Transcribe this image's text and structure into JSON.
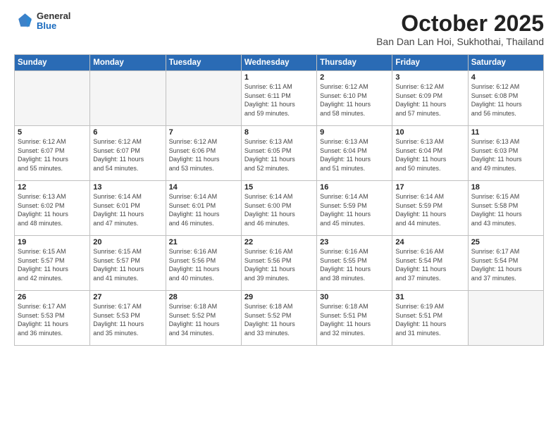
{
  "logo": {
    "general": "General",
    "blue": "Blue"
  },
  "header": {
    "month": "October 2025",
    "location": "Ban Dan Lan Hoi, Sukhothai, Thailand"
  },
  "weekdays": [
    "Sunday",
    "Monday",
    "Tuesday",
    "Wednesday",
    "Thursday",
    "Friday",
    "Saturday"
  ],
  "weeks": [
    [
      {
        "day": "",
        "info": ""
      },
      {
        "day": "",
        "info": ""
      },
      {
        "day": "",
        "info": ""
      },
      {
        "day": "1",
        "info": "Sunrise: 6:11 AM\nSunset: 6:11 PM\nDaylight: 11 hours\nand 59 minutes."
      },
      {
        "day": "2",
        "info": "Sunrise: 6:12 AM\nSunset: 6:10 PM\nDaylight: 11 hours\nand 58 minutes."
      },
      {
        "day": "3",
        "info": "Sunrise: 6:12 AM\nSunset: 6:09 PM\nDaylight: 11 hours\nand 57 minutes."
      },
      {
        "day": "4",
        "info": "Sunrise: 6:12 AM\nSunset: 6:08 PM\nDaylight: 11 hours\nand 56 minutes."
      }
    ],
    [
      {
        "day": "5",
        "info": "Sunrise: 6:12 AM\nSunset: 6:07 PM\nDaylight: 11 hours\nand 55 minutes."
      },
      {
        "day": "6",
        "info": "Sunrise: 6:12 AM\nSunset: 6:07 PM\nDaylight: 11 hours\nand 54 minutes."
      },
      {
        "day": "7",
        "info": "Sunrise: 6:12 AM\nSunset: 6:06 PM\nDaylight: 11 hours\nand 53 minutes."
      },
      {
        "day": "8",
        "info": "Sunrise: 6:13 AM\nSunset: 6:05 PM\nDaylight: 11 hours\nand 52 minutes."
      },
      {
        "day": "9",
        "info": "Sunrise: 6:13 AM\nSunset: 6:04 PM\nDaylight: 11 hours\nand 51 minutes."
      },
      {
        "day": "10",
        "info": "Sunrise: 6:13 AM\nSunset: 6:04 PM\nDaylight: 11 hours\nand 50 minutes."
      },
      {
        "day": "11",
        "info": "Sunrise: 6:13 AM\nSunset: 6:03 PM\nDaylight: 11 hours\nand 49 minutes."
      }
    ],
    [
      {
        "day": "12",
        "info": "Sunrise: 6:13 AM\nSunset: 6:02 PM\nDaylight: 11 hours\nand 48 minutes."
      },
      {
        "day": "13",
        "info": "Sunrise: 6:14 AM\nSunset: 6:01 PM\nDaylight: 11 hours\nand 47 minutes."
      },
      {
        "day": "14",
        "info": "Sunrise: 6:14 AM\nSunset: 6:01 PM\nDaylight: 11 hours\nand 46 minutes."
      },
      {
        "day": "15",
        "info": "Sunrise: 6:14 AM\nSunset: 6:00 PM\nDaylight: 11 hours\nand 46 minutes."
      },
      {
        "day": "16",
        "info": "Sunrise: 6:14 AM\nSunset: 5:59 PM\nDaylight: 11 hours\nand 45 minutes."
      },
      {
        "day": "17",
        "info": "Sunrise: 6:14 AM\nSunset: 5:59 PM\nDaylight: 11 hours\nand 44 minutes."
      },
      {
        "day": "18",
        "info": "Sunrise: 6:15 AM\nSunset: 5:58 PM\nDaylight: 11 hours\nand 43 minutes."
      }
    ],
    [
      {
        "day": "19",
        "info": "Sunrise: 6:15 AM\nSunset: 5:57 PM\nDaylight: 11 hours\nand 42 minutes."
      },
      {
        "day": "20",
        "info": "Sunrise: 6:15 AM\nSunset: 5:57 PM\nDaylight: 11 hours\nand 41 minutes."
      },
      {
        "day": "21",
        "info": "Sunrise: 6:16 AM\nSunset: 5:56 PM\nDaylight: 11 hours\nand 40 minutes."
      },
      {
        "day": "22",
        "info": "Sunrise: 6:16 AM\nSunset: 5:56 PM\nDaylight: 11 hours\nand 39 minutes."
      },
      {
        "day": "23",
        "info": "Sunrise: 6:16 AM\nSunset: 5:55 PM\nDaylight: 11 hours\nand 38 minutes."
      },
      {
        "day": "24",
        "info": "Sunrise: 6:16 AM\nSunset: 5:54 PM\nDaylight: 11 hours\nand 37 minutes."
      },
      {
        "day": "25",
        "info": "Sunrise: 6:17 AM\nSunset: 5:54 PM\nDaylight: 11 hours\nand 37 minutes."
      }
    ],
    [
      {
        "day": "26",
        "info": "Sunrise: 6:17 AM\nSunset: 5:53 PM\nDaylight: 11 hours\nand 36 minutes."
      },
      {
        "day": "27",
        "info": "Sunrise: 6:17 AM\nSunset: 5:53 PM\nDaylight: 11 hours\nand 35 minutes."
      },
      {
        "day": "28",
        "info": "Sunrise: 6:18 AM\nSunset: 5:52 PM\nDaylight: 11 hours\nand 34 minutes."
      },
      {
        "day": "29",
        "info": "Sunrise: 6:18 AM\nSunset: 5:52 PM\nDaylight: 11 hours\nand 33 minutes."
      },
      {
        "day": "30",
        "info": "Sunrise: 6:18 AM\nSunset: 5:51 PM\nDaylight: 11 hours\nand 32 minutes."
      },
      {
        "day": "31",
        "info": "Sunrise: 6:19 AM\nSunset: 5:51 PM\nDaylight: 11 hours\nand 31 minutes."
      },
      {
        "day": "",
        "info": ""
      }
    ]
  ]
}
